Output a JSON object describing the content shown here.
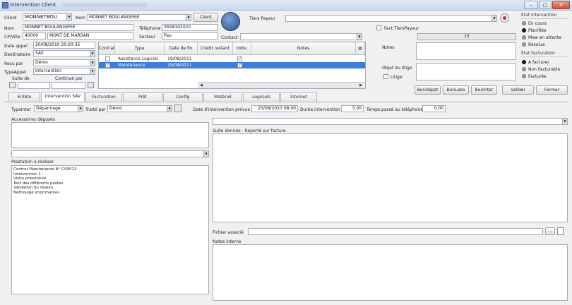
{
  "window": {
    "title": "Intervention Client",
    "min": "–",
    "max": "▢",
    "close": "✕"
  },
  "header": {
    "client_label": "Client",
    "client_code": "MONNETBOU",
    "nom_label": "Nom",
    "nom_value": "MONNET BOULANGERIE",
    "client_button": "Client",
    "tiers_label": "Tiers Payeur",
    "tiers_value": "",
    "nom2_label": "Nom",
    "nom2_value": "MONNET BOULANGERIE",
    "tel_label": "Téléphone",
    "tel_value": "0558102020",
    "cp_label": "CP/Ville",
    "cp_value": "40000",
    "ville_value": "MONT DE MARSAN",
    "secteur_label": "Secteur",
    "secteur_value": "Pau",
    "date_label": "Date appel",
    "date_value": "20/08/2010 20:20:35",
    "contact_label": "Contact",
    "contact_value": "",
    "dest_label": "Destinataire",
    "dest_value": "SAV",
    "recu_label": "Reçu par",
    "recu_value": "Démo",
    "type_label": "TypeAppel",
    "type_value": "Intervention",
    "suite_label": "Suite de",
    "continue_label": "Continué par"
  },
  "grid": {
    "headers": [
      "Contrat",
      "Type",
      "Date de fin",
      "Crédit restant",
      "Indiv.",
      "Notes"
    ],
    "rows": [
      {
        "contrat": false,
        "type": "Assistance Logiciel",
        "date": "19/08/2011",
        "indiv": true,
        "notes": ""
      },
      {
        "contrat": true,
        "type": "Maintenance",
        "date": "19/08/2011",
        "indiv": true,
        "notes": ""
      }
    ]
  },
  "right": {
    "fact_label": "Fact.TiersPayeur",
    "count_value": "15",
    "notes_label": "Notes",
    "objet_label": "Objet du litige",
    "litige_label": "Litige",
    "etat_title": "Etat Intervention",
    "etat": [
      "En cours",
      "Planifiée",
      "Mise en attente",
      "Résolue"
    ],
    "etat_selected": 1,
    "facturation_title": "Etat Facturation",
    "facturation": [
      "A facturer",
      "Non Facturable",
      "Facturée"
    ],
    "facturation_selected": 0,
    "buttons": [
      "BonDépot",
      "BonLabo",
      "BonInter",
      "Valider",
      "Fermer"
    ]
  },
  "tabs": [
    "Entête",
    "Intervention SAV",
    "Facturation",
    "Prêt",
    "Config",
    "Matériel",
    "Logiciels",
    "Internet"
  ],
  "tab_active": 1,
  "sav": {
    "typeinter_label": "TypeInter",
    "typeinter_value": "Dépannage",
    "traite_label": "Traité par",
    "traite_value": "Démo",
    "date_prevue_label": "Date d'intervention prévue",
    "date_prevue_value": "23/08/2010 08:00",
    "duree_label": "Durée intervention",
    "duree_value": "3.00",
    "temps_label": "Temps passé au téléphone",
    "temps_value": "0.00",
    "accessoires_label": "Accessoires déposés",
    "suite_label": "Suite donnée - Reporté sur facture",
    "prestation_label": "Prestation à réaliser",
    "prestation_lines": [
      "Contrat Maintenance N° C00013",
      "Intervention 1 :",
      "Visite préventive.",
      "Test des différents postes.",
      "Validation du réseau",
      "Nettoyage imprimantes"
    ],
    "fichier_label": "Fichier associé",
    "fichier_button": "...",
    "notes_interne_label": "Notes interne"
  }
}
